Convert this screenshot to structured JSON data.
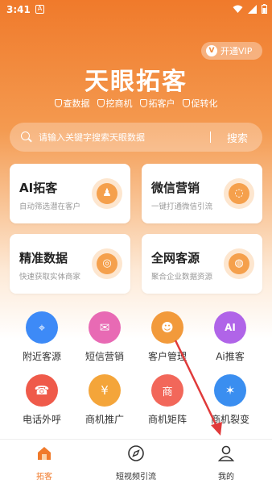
{
  "status_bar": {
    "time": "3:41",
    "a_badge": "A"
  },
  "vip": {
    "badge": "V",
    "label": "开通VIP"
  },
  "header": {
    "title": "天眼拓客",
    "tags": [
      "查数据",
      "挖商机",
      "拓客户",
      "促转化"
    ]
  },
  "search": {
    "placeholder": "请输入关键字搜索天眼数据",
    "button": "搜索"
  },
  "cards": [
    {
      "title": "AI拓客",
      "subtitle": "自动筛选潜在客户",
      "icon": "user-tie-icon"
    },
    {
      "title": "微信营销",
      "subtitle": "一键打通微信引流",
      "icon": "wechat-icon"
    },
    {
      "title": "精准数据",
      "subtitle": "快速获取实体商家",
      "icon": "target-icon"
    },
    {
      "title": "全网客源",
      "subtitle": "聚合企业数据资源",
      "icon": "globe-icon"
    }
  ],
  "features": [
    {
      "label": "附近客源",
      "icon": "location-pin-icon",
      "color": "#3d8af7",
      "glyph": "⌖"
    },
    {
      "label": "短信营销",
      "icon": "sms-icon",
      "color": "#e86ab4",
      "glyph": "✉"
    },
    {
      "label": "客户管理",
      "icon": "contacts-icon",
      "color": "#f29a3b",
      "glyph": "☻"
    },
    {
      "label": "Ai推客",
      "icon": "ai-phone-icon",
      "color": "#b064e8",
      "glyph": "AI"
    },
    {
      "label": "电话外呼",
      "icon": "phone-icon",
      "color": "#ef5a4a",
      "glyph": "☎"
    },
    {
      "label": "商机推广",
      "icon": "money-bag-icon",
      "color": "#f4a53a",
      "glyph": "¥"
    },
    {
      "label": "商机矩阵",
      "icon": "shop-icon",
      "color": "#f2675a",
      "glyph": "商"
    },
    {
      "label": "商机裂变",
      "icon": "network-icon",
      "color": "#3a8ef0",
      "glyph": "✶"
    }
  ],
  "tabbar": [
    {
      "label": "拓客",
      "icon": "home-icon",
      "active": true
    },
    {
      "label": "短视频引流",
      "icon": "compass-icon",
      "active": false
    },
    {
      "label": "我的",
      "icon": "person-icon",
      "active": false
    }
  ]
}
